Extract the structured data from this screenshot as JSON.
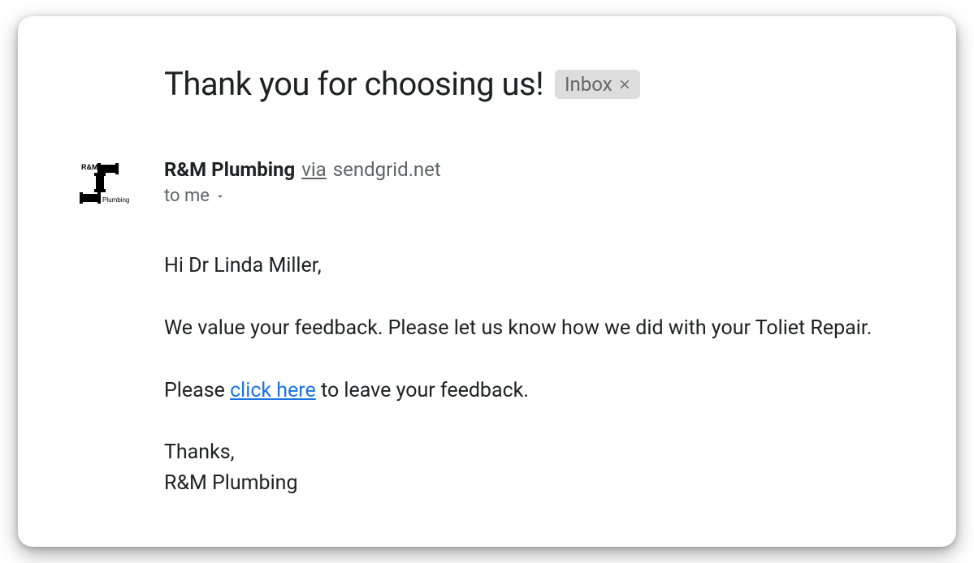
{
  "subject": "Thank you for choosing us!",
  "label": {
    "text": "Inbox"
  },
  "sender": {
    "name": "R&M Plumbing",
    "via_word": "via",
    "via_domain": "sendgrid.net",
    "logo_top_text": "R&M",
    "logo_bottom_text": "Plumbing"
  },
  "recipient": {
    "to_text": "to me"
  },
  "body": {
    "greeting": "Hi Dr Linda Miller,",
    "feedback_line": "We value your feedback. Please let us know how we did with your Toliet Repair.",
    "please_prefix": "Please ",
    "link_text": "click here",
    "please_suffix": " to leave your feedback.",
    "thanks": "Thanks,",
    "signature": "R&M Plumbing"
  }
}
